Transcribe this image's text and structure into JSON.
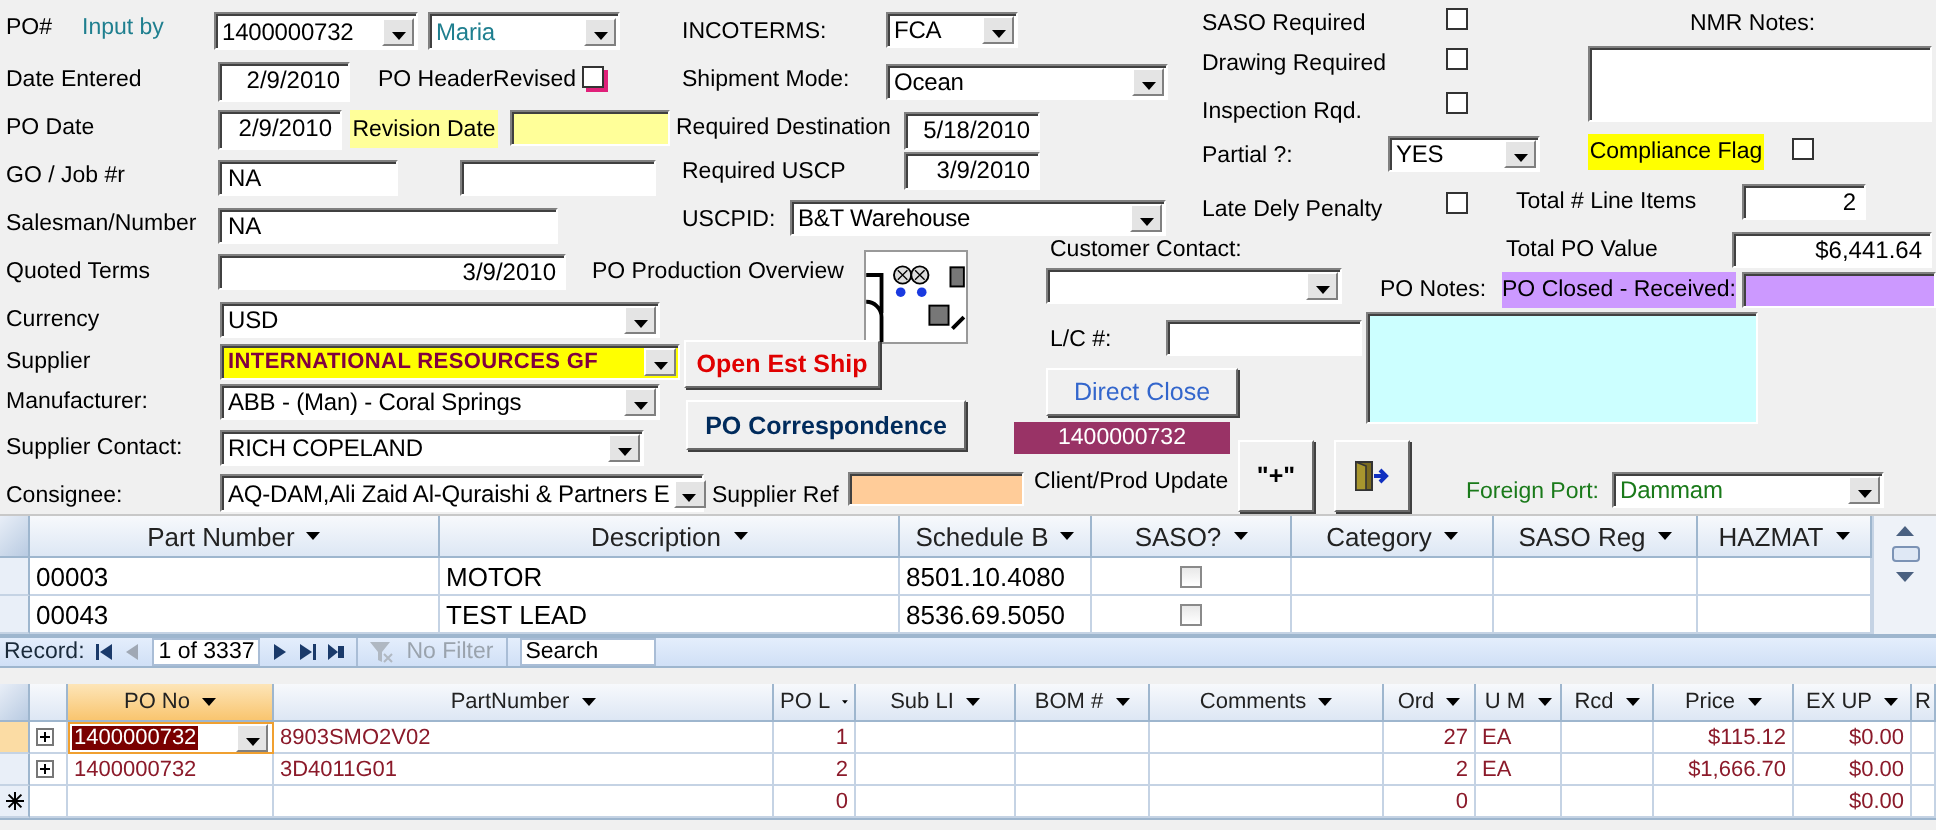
{
  "form": {
    "controls": [
      {
        "kind": "label",
        "text": "PO#"
      },
      {
        "kind": "label",
        "text": "Input by"
      },
      {
        "kind": "combo",
        "value": "1400000732"
      },
      {
        "kind": "combo",
        "value": "Maria"
      },
      {
        "kind": "label",
        "text": "INCOTERMS:"
      },
      {
        "kind": "combo",
        "value": "FCA"
      },
      {
        "kind": "label",
        "text": "SASO Required"
      },
      {
        "kind": "check",
        "checked": false
      },
      {
        "kind": "label",
        "text": "NMR Notes:"
      },
      {
        "kind": "label",
        "text": "Date Entered"
      },
      {
        "kind": "text",
        "value": "2/9/2010"
      },
      {
        "kind": "label",
        "text": "PO HeaderRevised"
      },
      {
        "kind": "check",
        "checked": false
      },
      {
        "kind": "label",
        "text": "Shipment Mode:"
      },
      {
        "kind": "combo",
        "value": "Ocean"
      },
      {
        "kind": "label",
        "text": "Drawing Required"
      },
      {
        "kind": "check",
        "checked": false
      },
      {
        "kind": "memo"
      },
      {
        "kind": "label",
        "text": "Inspection Rqd."
      },
      {
        "kind": "check",
        "checked": false
      },
      {
        "kind": "label",
        "text": "PO Date"
      },
      {
        "kind": "text",
        "value": "2/9/2010"
      },
      {
        "kind": "tag",
        "text": "Revision Date"
      },
      {
        "kind": "text"
      },
      {
        "kind": "label",
        "text": "Required Destination"
      },
      {
        "kind": "text",
        "value": "5/18/2010"
      },
      {
        "kind": "label",
        "text": "Partial ?:"
      },
      {
        "kind": "combo",
        "value": "YES"
      },
      {
        "kind": "tag",
        "text": "Compliance Flag"
      },
      {
        "kind": "check",
        "checked": false
      },
      {
        "kind": "label",
        "text": "GO / Job #r"
      },
      {
        "kind": "text",
        "value": "NA"
      },
      {
        "kind": "text"
      },
      {
        "kind": "label",
        "text": "Required USCP"
      },
      {
        "kind": "text",
        "value": "3/9/2010"
      },
      {
        "kind": "label",
        "text": "Late Dely Penalty"
      },
      {
        "kind": "check",
        "checked": false
      },
      {
        "kind": "label",
        "text": "Total # Line Items"
      },
      {
        "kind": "text",
        "value": "2"
      },
      {
        "kind": "label",
        "text": "Salesman/Number"
      },
      {
        "kind": "text",
        "value": "NA"
      },
      {
        "kind": "label",
        "text": "USCPID:"
      },
      {
        "kind": "combo",
        "value": "B&T Warehouse"
      },
      {
        "kind": "label",
        "text": "Customer Contact:"
      },
      {
        "kind": "label",
        "text": "Total PO Value"
      },
      {
        "kind": "text",
        "value": "$6,441.64"
      },
      {
        "kind": "label",
        "text": "Quoted Terms"
      },
      {
        "kind": "text",
        "value": "3/9/2010"
      },
      {
        "kind": "label",
        "text": "PO Production Overview"
      },
      {
        "kind": "picture"
      },
      {
        "kind": "combo"
      },
      {
        "kind": "label",
        "text": "PO Notes:"
      },
      {
        "kind": "tag",
        "text": "PO Closed - Received:"
      },
      {
        "kind": "text"
      },
      {
        "kind": "label",
        "text": "Currency"
      },
      {
        "kind": "combo",
        "value": "USD"
      },
      {
        "kind": "memo"
      },
      {
        "kind": "label",
        "text": "L/C #:"
      },
      {
        "kind": "text"
      },
      {
        "kind": "label",
        "text": "Supplier"
      },
      {
        "kind": "combo",
        "value": "INTERNATIONAL RESOURCES GF"
      },
      {
        "kind": "button",
        "text": "Open Est Ship"
      },
      {
        "kind": "button",
        "text": "Direct Close"
      },
      {
        "kind": "label",
        "text": "Manufacturer:"
      },
      {
        "kind": "combo",
        "value": "ABB - (Man) - Coral Springs"
      },
      {
        "kind": "button",
        "text": "PO Correspondence"
      },
      {
        "kind": "tag",
        "text": "1400000732"
      },
      {
        "kind": "label",
        "text": "Supplier Contact:"
      },
      {
        "kind": "combo",
        "value": "RICH COPELAND"
      },
      {
        "kind": "button",
        "text": "\"+\""
      },
      {
        "kind": "exit"
      },
      {
        "kind": "label",
        "text": "Consignee:"
      },
      {
        "kind": "combo",
        "value": "AQ-DAM,Ali Zaid Al-Quraishi & Partners E"
      },
      {
        "kind": "label",
        "text": "Supplier Ref"
      },
      {
        "kind": "text"
      },
      {
        "kind": "label",
        "text": "Client/Prod Update"
      },
      {
        "kind": "label",
        "text": "Foreign Port:"
      },
      {
        "kind": "combo",
        "value": "Dammam"
      }
    ]
  },
  "parts_list": {
    "columns": [
      "Part Number",
      "Description",
      "Schedule B",
      "SASO?",
      "Category",
      "SASO Reg",
      "HAZMAT"
    ],
    "rows": [
      {
        "cells": [
          "00003",
          "MOTOR",
          "8501.10.4080"
        ],
        "saso": false
      },
      {
        "cells": [
          "00043",
          "TEST LEAD",
          "8536.69.5050"
        ],
        "saso": false
      }
    ],
    "navigation": {
      "label": "Record:",
      "position": "1 of 3337",
      "filter": "No Filter",
      "filter_disabled": true,
      "search_placeholder": "Search"
    }
  },
  "line_items": {
    "columns": [
      {
        "label": "PO No",
        "selected": true
      },
      {
        "label": "PartNumber",
        "selected": false
      },
      {
        "label": "PO L",
        "selected": false
      },
      {
        "label": "Sub LI",
        "selected": false
      },
      {
        "label": "BOM #",
        "selected": false
      },
      {
        "label": "Comments",
        "selected": false
      },
      {
        "label": "Ord",
        "selected": false
      },
      {
        "label": "U M",
        "selected": false
      },
      {
        "label": "Rcd",
        "selected": false
      },
      {
        "label": "Price",
        "selected": false
      },
      {
        "label": "EX UP",
        "selected": false
      },
      {
        "label": "R",
        "selected": false
      }
    ],
    "rows": [
      {
        "selected": true,
        "cells": [
          "1400000732",
          "8903SMO2V02",
          "1",
          null,
          null,
          null,
          "27",
          "EA",
          null,
          "$115.12",
          "$0.00"
        ]
      },
      {
        "selected": false,
        "cells": [
          "1400000732",
          "3D4011G01",
          "2",
          null,
          null,
          null,
          "2",
          "EA",
          null,
          "$1,666.70",
          "$0.00"
        ]
      }
    ],
    "new_row": {
      "cells": [
        null,
        null,
        "0",
        null,
        null,
        null,
        "0",
        null,
        null,
        null,
        "$0.00"
      ]
    }
  }
}
